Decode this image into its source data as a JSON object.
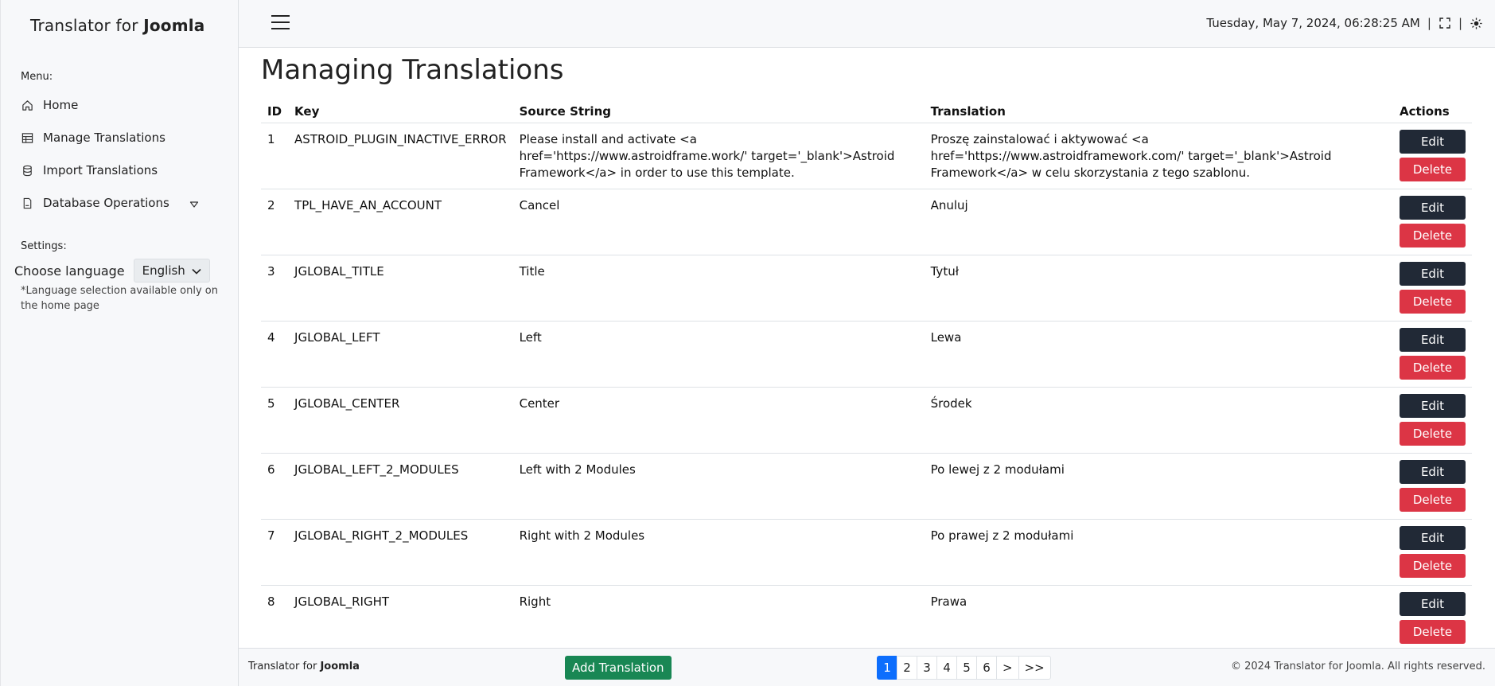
{
  "sidebar": {
    "brand_prefix": "Translator for ",
    "brand_strong": "Joomla",
    "menu_label": "Menu:",
    "items": [
      {
        "label": "Home",
        "icon": "home-icon"
      },
      {
        "label": "Manage Translations",
        "icon": "table-icon"
      },
      {
        "label": "Import Translations",
        "icon": "database-icon"
      },
      {
        "label": "Database Operations",
        "icon": "file-icon"
      }
    ],
    "settings_label": "Settings:",
    "choose_language_label": "Choose language",
    "language_value": "English",
    "language_note": "*Language selection available only on the home page"
  },
  "header": {
    "datetime": "Tuesday, May 7, 2024, 06:28:25 AM",
    "separator": "|"
  },
  "main": {
    "title": "Managing Translations",
    "columns": {
      "id": "ID",
      "key": "Key",
      "source": "Source String",
      "translation": "Translation",
      "actions": "Actions"
    },
    "edit_label": "Edit",
    "delete_label": "Delete",
    "rows": [
      {
        "id": "1",
        "key": "ASTROID_PLUGIN_INACTIVE_ERROR",
        "source": "Please install and activate <a href='https://www.astroidframe.work/' target='_blank'>Astroid Framework</a> in order to use this template.",
        "translation": "Proszę zainstalować i aktywować <a href='https://www.astroidframework.com/' target='_blank'>Astroid Framework</a> w celu skorzystania z tego szablonu."
      },
      {
        "id": "2",
        "key": "TPL_HAVE_AN_ACCOUNT",
        "source": "Cancel",
        "translation": "Anuluj"
      },
      {
        "id": "3",
        "key": "JGLOBAL_TITLE",
        "source": "Title",
        "translation": "Tytuł"
      },
      {
        "id": "4",
        "key": "JGLOBAL_LEFT",
        "source": "Left",
        "translation": "Lewa"
      },
      {
        "id": "5",
        "key": "JGLOBAL_CENTER",
        "source": "Center",
        "translation": "Środek"
      },
      {
        "id": "6",
        "key": "JGLOBAL_LEFT_2_MODULES",
        "source": "Left with 2 Modules",
        "translation": "Po lewej z 2 modułami"
      },
      {
        "id": "7",
        "key": "JGLOBAL_RIGHT_2_MODULES",
        "source": "Right with 2 Modules",
        "translation": "Po prawej z 2 modułami"
      },
      {
        "id": "8",
        "key": "JGLOBAL_RIGHT",
        "source": "Right",
        "translation": "Prawa"
      }
    ]
  },
  "footer": {
    "brand_prefix": "Translator for ",
    "brand_strong": "Joomla",
    "add_button": "Add Translation",
    "pages": [
      "1",
      "2",
      "3",
      "4",
      "5",
      "6",
      ">",
      ">>"
    ],
    "active_page": "1",
    "copyright": "© 2024 Translator for Joomla. All rights reserved."
  },
  "colors": {
    "edit_button": "#212936",
    "delete_button": "#dc3545",
    "add_button": "#198754",
    "active_page": "#0d6efd"
  }
}
